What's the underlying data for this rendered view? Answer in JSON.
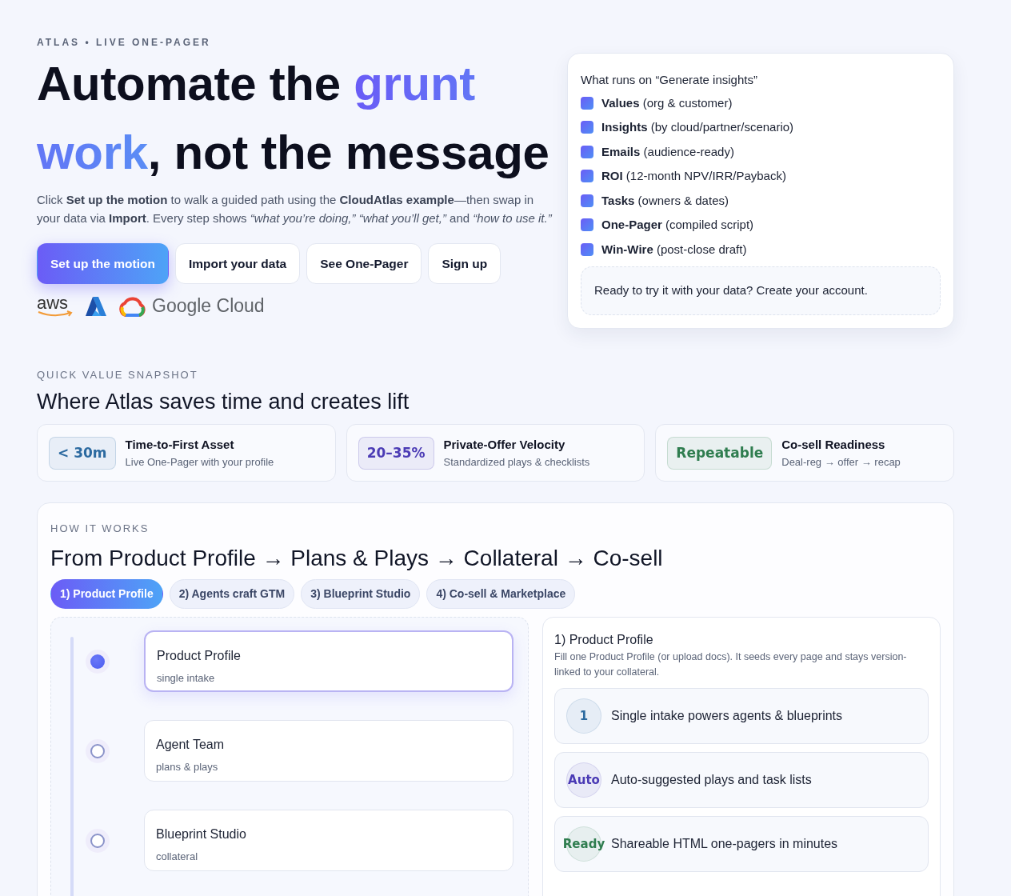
{
  "eyebrow": "ATLAS • LIVE ONE-PAGER",
  "headline": [
    {
      "text": "Automate the ",
      "accent": false
    },
    {
      "text": "grunt work",
      "accent": true
    },
    {
      "text": ", not the message",
      "accent": false
    }
  ],
  "intro": "Click **Set up the motion** to walk a guided path using the **CloudAtlas example**—then swap in your data via **Import**. Every step shows *“what you’re doing,” “what you’ll get,”* and *“how to use it.”*",
  "actions": [
    {
      "label": "Set up the motion",
      "primary": true
    },
    {
      "label": "Import your data",
      "primary": false
    },
    {
      "label": "See One-Pager",
      "primary": false
    },
    {
      "label": "Sign up",
      "primary": false
    }
  ],
  "logos": [
    {
      "kind": "aws",
      "label": "aws"
    },
    {
      "kind": "azure"
    },
    {
      "kind": "gcp",
      "label": "Google Cloud"
    }
  ],
  "runs_card": {
    "title": "What runs on “Generate insights”",
    "items": [
      "**Values** (org & customer)",
      "**Insights** (by cloud/partner/scenario)",
      "**Emails** (audience-ready)",
      "**ROI** (12-month NPV/IRR/Payback)",
      "**Tasks** (owners & dates)",
      "**One-Pager** (compiled script)",
      "**Win-Wire** (post-close draft)"
    ],
    "cta": "Ready to try it with your data? Create your account."
  },
  "snapshot": {
    "eyebrow": "QUICK VALUE SNAPSHOT",
    "title": "Where Atlas saves time and creates lift",
    "cards": [
      {
        "badge": "< 30m",
        "color": "#2c6aa0",
        "title": "Time-to-First Asset",
        "subtitle": "Live One-Pager with your profile"
      },
      {
        "badge": "20–35%",
        "color": "#4b3bb5",
        "title": "Private-Offer Velocity",
        "subtitle": "Standardized plays & checklists"
      },
      {
        "badge": "Repeatable",
        "color": "#2f7d4f",
        "title": "Co-sell Readiness",
        "subtitle": "Deal-reg → offer → recap"
      }
    ]
  },
  "how": {
    "eyebrow": "HOW IT WORKS",
    "title": "From Product Profile → Plans & Plays → Collateral → Co-sell",
    "tabs": [
      {
        "label": "1) Product Profile",
        "selected": true
      },
      {
        "label": "2) Agents craft GTM",
        "selected": false
      },
      {
        "label": "3) Blueprint Studio",
        "selected": false
      },
      {
        "label": "4) Co-sell & Marketplace",
        "selected": false
      }
    ],
    "steps": [
      {
        "title": "Product Profile",
        "subtitle": "single intake",
        "selected": true
      },
      {
        "title": "Agent Team",
        "subtitle": "plans & plays",
        "selected": false
      },
      {
        "title": "Blueprint Studio",
        "subtitle": "collateral",
        "selected": false
      }
    ],
    "detail": {
      "title": "1) Product Profile",
      "description": "Fill one Product Profile (or upload docs). It seeds every page and stays version-linked to your collateral.",
      "features": [
        {
          "badge": "1",
          "color": "#2c6aa0",
          "text": "Single intake powers agents & blueprints"
        },
        {
          "badge": "Auto",
          "color": "#4b3bb5",
          "text": "Auto-suggested plays and task lists"
        },
        {
          "badge": "Ready",
          "color": "#2f7d4f",
          "text": "Shareable HTML one-pagers in minutes"
        }
      ]
    }
  }
}
